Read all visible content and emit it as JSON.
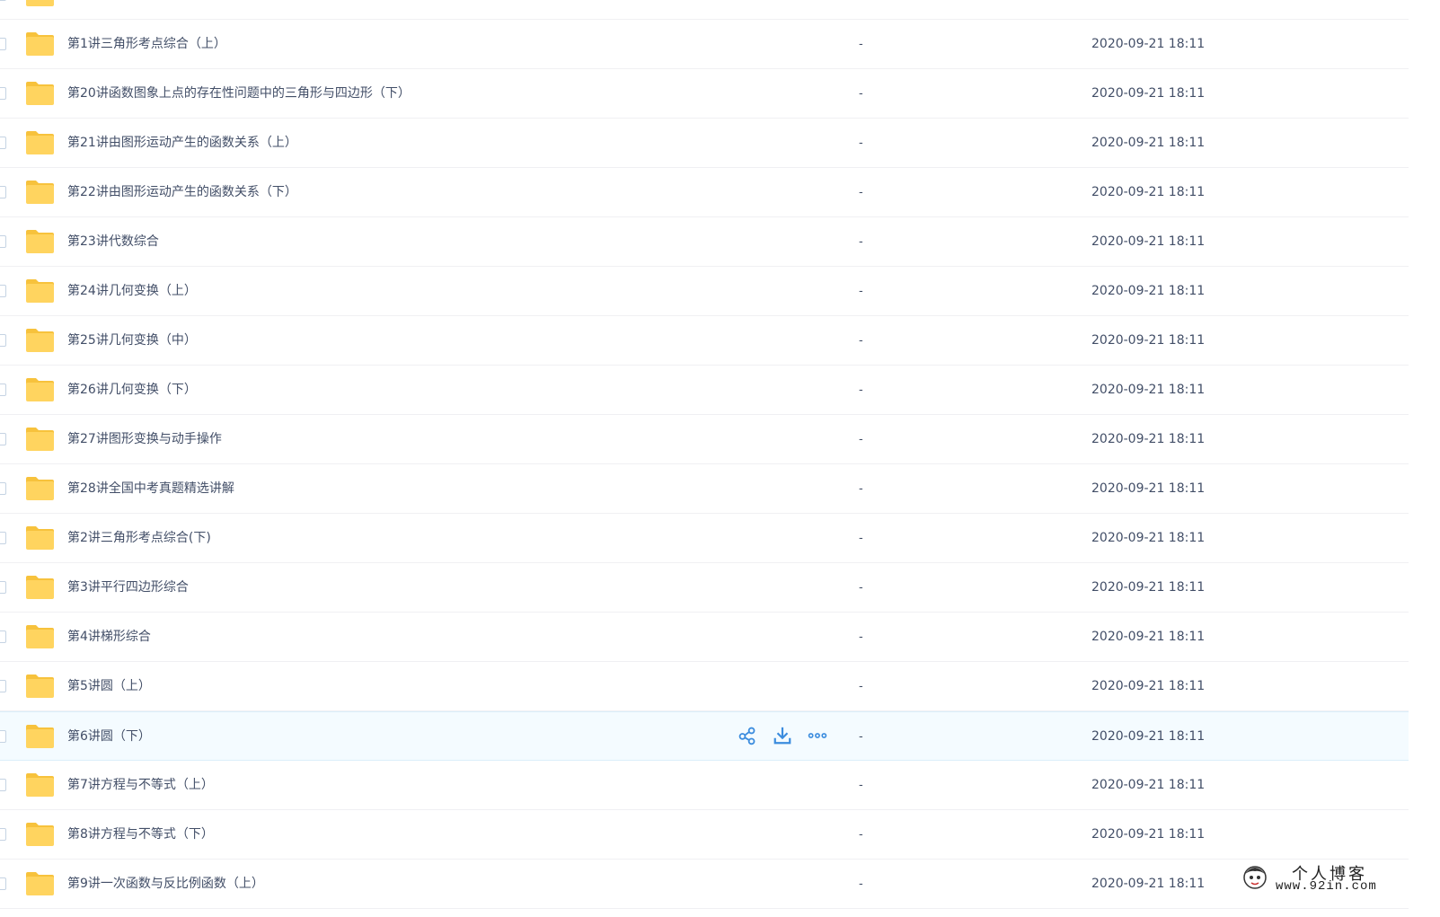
{
  "file_list": {
    "rows": [
      {
        "name": "",
        "size": "",
        "modified": ""
      },
      {
        "name": "第1讲三角形考点综合（上）",
        "size": "-",
        "modified": "2020-09-21 18:11"
      },
      {
        "name": "第20讲函数图象上点的存在性问题中的三角形与四边形（下）",
        "size": "-",
        "modified": "2020-09-21 18:11"
      },
      {
        "name": "第21讲由图形运动产生的函数关系（上）",
        "size": "-",
        "modified": "2020-09-21 18:11"
      },
      {
        "name": "第22讲由图形运动产生的函数关系（下）",
        "size": "-",
        "modified": "2020-09-21 18:11"
      },
      {
        "name": "第23讲代数综合",
        "size": "-",
        "modified": "2020-09-21 18:11"
      },
      {
        "name": "第24讲几何变换（上）",
        "size": "-",
        "modified": "2020-09-21 18:11"
      },
      {
        "name": "第25讲几何变换（中）",
        "size": "-",
        "modified": "2020-09-21 18:11"
      },
      {
        "name": "第26讲几何变换（下）",
        "size": "-",
        "modified": "2020-09-21 18:11"
      },
      {
        "name": "第27讲图形变换与动手操作",
        "size": "-",
        "modified": "2020-09-21 18:11"
      },
      {
        "name": "第28讲全国中考真题精选讲解",
        "size": "-",
        "modified": "2020-09-21 18:11"
      },
      {
        "name": "第2讲三角形考点综合(下)",
        "size": "-",
        "modified": "2020-09-21 18:11"
      },
      {
        "name": "第3讲平行四边形综合",
        "size": "-",
        "modified": "2020-09-21 18:11"
      },
      {
        "name": "第4讲梯形综合",
        "size": "-",
        "modified": "2020-09-21 18:11"
      },
      {
        "name": "第5讲圆（上）",
        "size": "-",
        "modified": "2020-09-21 18:11"
      },
      {
        "name": "第6讲圆（下）",
        "size": "-",
        "modified": "2020-09-21 18:11",
        "hovered": true
      },
      {
        "name": "第7讲方程与不等式（上）",
        "size": "-",
        "modified": "2020-09-21 18:11"
      },
      {
        "name": "第8讲方程与不等式（下）",
        "size": "-",
        "modified": "2020-09-21 18:11"
      },
      {
        "name": "第9讲一次函数与反比例函数（上）",
        "size": "-",
        "modified": "2020-09-21 18:11"
      }
    ],
    "row_actions": [
      {
        "icon": "share-icon"
      },
      {
        "icon": "download-icon"
      },
      {
        "icon": "more-icon"
      }
    ]
  },
  "watermark": {
    "text_cn": "个人博客",
    "url": "www.92in.com"
  },
  "colors": {
    "folder": "#ffd45f",
    "folder_tab": "#f7c23c",
    "text": "#424e67",
    "action_blue": "#3b8cde",
    "hover_bg": "#f4fbff",
    "divider": "#f0f0f3"
  }
}
